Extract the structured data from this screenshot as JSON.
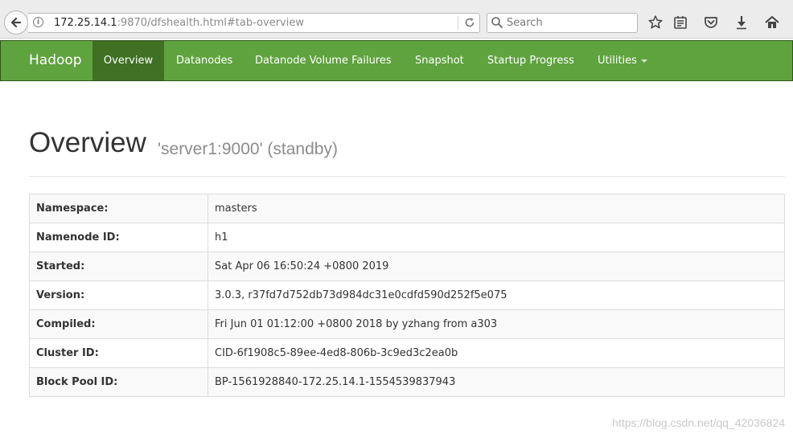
{
  "browser": {
    "url_host": "172.25.14.1",
    "url_rest": ":9870/dfshealth.html#tab-overview",
    "search_placeholder": "Search",
    "icons": [
      "back-icon",
      "info-icon",
      "reload-icon",
      "search-icon",
      "bookmark-star-icon",
      "reading-list-icon",
      "pocket-icon",
      "download-icon",
      "home-icon"
    ]
  },
  "navbar": {
    "brand": "Hadoop",
    "items": [
      {
        "label": "Overview",
        "active": true
      },
      {
        "label": "Datanodes"
      },
      {
        "label": "Datanode Volume Failures"
      },
      {
        "label": "Snapshot"
      },
      {
        "label": "Startup Progress"
      },
      {
        "label": "Utilities",
        "dropdown": true
      }
    ],
    "color": "#5fa33e",
    "active_color": "#3f7024"
  },
  "header": {
    "title": "Overview",
    "subtitle": "'server1:9000' (standby)"
  },
  "info_table": [
    {
      "key": "Namespace:",
      "value": "masters"
    },
    {
      "key": "Namenode ID:",
      "value": "h1"
    },
    {
      "key": "Started:",
      "value": "Sat Apr 06 16:50:24 +0800 2019"
    },
    {
      "key": "Version:",
      "value": "3.0.3, r37fd7d752db73d984dc31e0cdfd590d252f5e075"
    },
    {
      "key": "Compiled:",
      "value": "Fri Jun 01 01:12:00 +0800 2018 by yzhang from a303"
    },
    {
      "key": "Cluster ID:",
      "value": "CID-6f1908c5-89ee-4ed8-806b-3c9ed3c2ea0b"
    },
    {
      "key": "Block Pool ID:",
      "value": "BP-1561928840-172.25.14.1-1554539837943"
    }
  ],
  "watermark": "https://blog.csdn.net/qq_42036824"
}
